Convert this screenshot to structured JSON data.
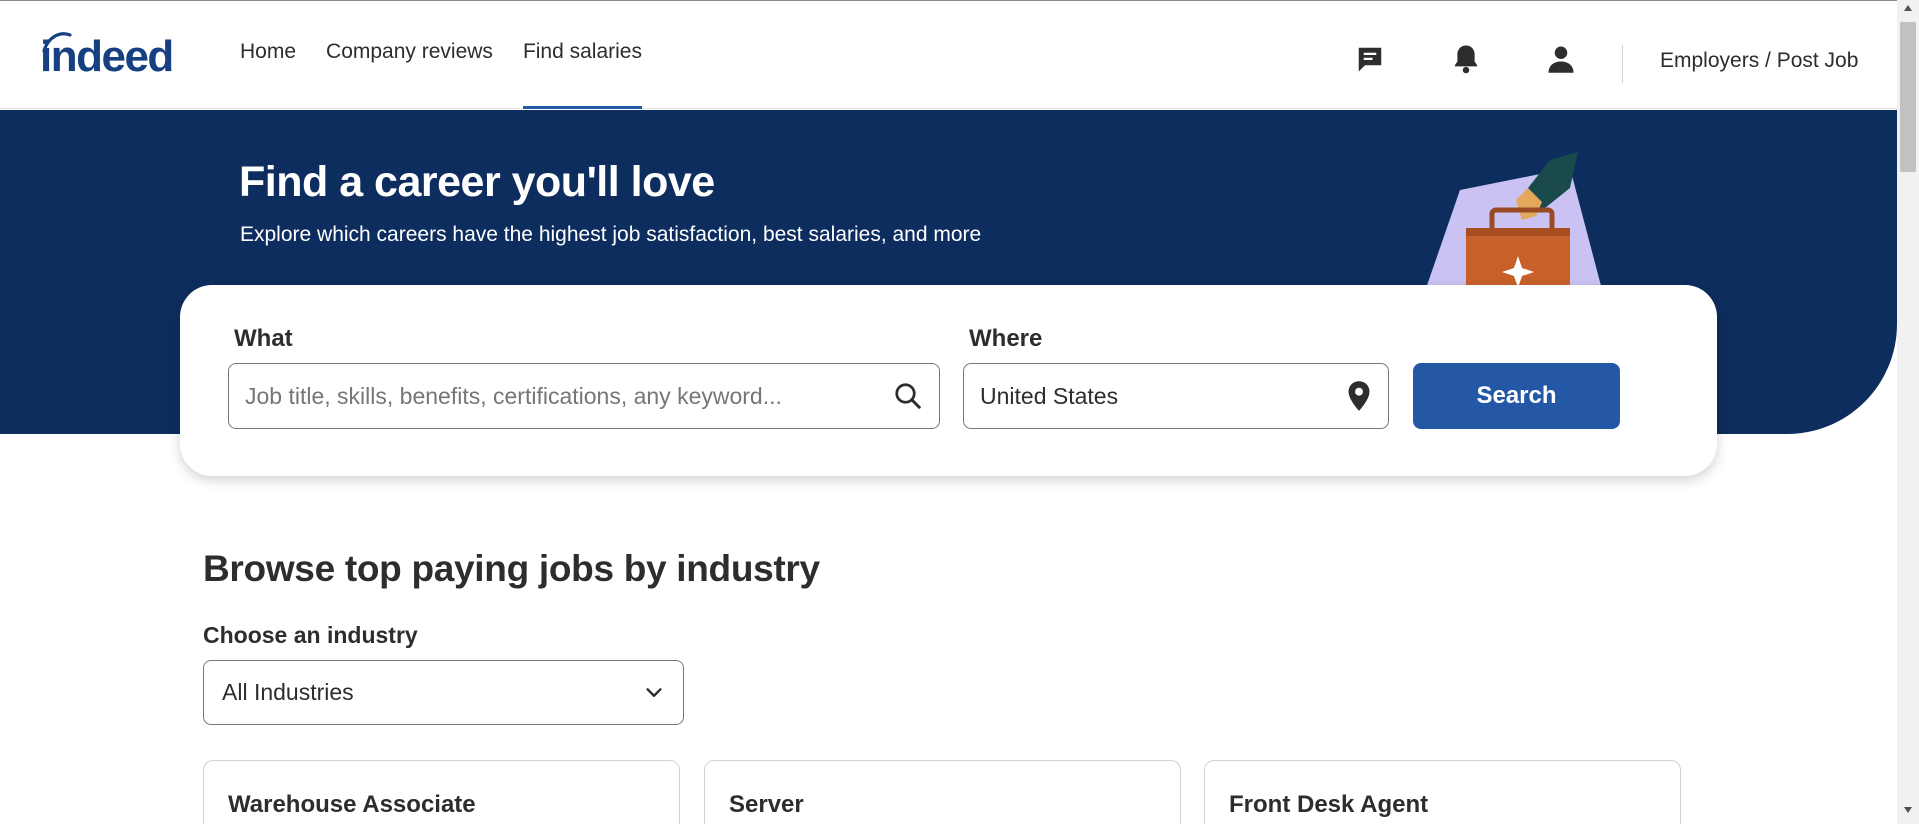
{
  "header": {
    "logo_text": "indeed",
    "nav": [
      {
        "label": "Home",
        "active": false
      },
      {
        "label": "Company reviews",
        "active": false
      },
      {
        "label": "Find salaries",
        "active": true
      }
    ],
    "icons": [
      "messages-icon",
      "notifications-bell-icon",
      "profile-icon"
    ],
    "employers_label": "Employers / Post Job"
  },
  "hero": {
    "title": "Find a career you'll love",
    "subtitle": "Explore which careers have the highest job satisfaction, best salaries, and more"
  },
  "search": {
    "what_label": "What",
    "what_placeholder": "Job title, skills, benefits, certifications, any keyword...",
    "where_label": "Where",
    "where_value": "United States",
    "button_label": "Search"
  },
  "browse": {
    "title": "Browse top paying jobs by industry",
    "industry_label": "Choose an industry",
    "industry_selected": "All Industries",
    "jobs": [
      {
        "title": "Warehouse Associate"
      },
      {
        "title": "Server"
      },
      {
        "title": "Front Desk Agent"
      }
    ]
  },
  "colors": {
    "brand": "#2557a7",
    "hero_bg": "#0d2d5e",
    "logo": "#164081"
  }
}
